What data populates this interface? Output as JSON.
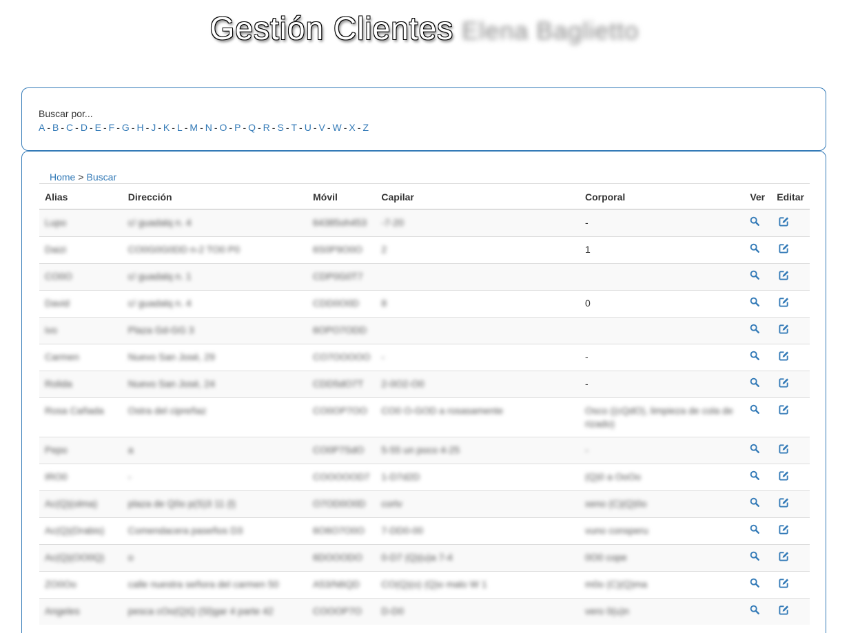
{
  "header": {
    "title": "Gestión Clientes",
    "owner_name": "Elena Baglietto"
  },
  "search": {
    "label": "Buscar por...",
    "letters": [
      "A",
      "B",
      "C",
      "D",
      "E",
      "F",
      "G",
      "H",
      "J",
      "K",
      "L",
      "M",
      "N",
      "O",
      "P",
      "Q",
      "R",
      "S",
      "T",
      "U",
      "V",
      "W",
      "X",
      "Z"
    ],
    "separator": "-"
  },
  "breadcrumb": {
    "home": "Home",
    "separator": ">",
    "current": "Buscar"
  },
  "table": {
    "headers": {
      "alias": "Alias",
      "direccion": "Dirección",
      "movil": "Móvil",
      "capilar": "Capilar",
      "corporal": "Corporal",
      "ver": "Ver",
      "editar": "Editar"
    },
    "rows": [
      {
        "alias": "Lupo",
        "direccion": "c/ guadalq n. 4",
        "movil": "64385oh453",
        "capilar": "-7-20",
        "corporal": "-",
        "corporal_clear": true
      },
      {
        "alias": "Daizi",
        "direccion": "CO0G0G0DD n-2 TO0 P0",
        "movil": "6S0P9O0O",
        "capilar": "2",
        "corporal": "1",
        "corporal_clear": true
      },
      {
        "alias": "CO0O",
        "direccion": "c/ guadalq n. 1",
        "movil": "CDP0G0T7",
        "capilar": "",
        "corporal": "",
        "corporal_clear": true
      },
      {
        "alias": "David",
        "direccion": "c/ guadalq n. 4",
        "movil": "CDD0O0D",
        "capilar": "8",
        "corporal": "0",
        "corporal_clear": true
      },
      {
        "alias": "ivo",
        "direccion": "Plaza Gd-GG 3",
        "movil": "6OPO7ODD",
        "capilar": "",
        "corporal": "",
        "corporal_clear": true
      },
      {
        "alias": "Carmen",
        "direccion": "Nuevo San José, 29",
        "movil": "CO7OOOOO",
        "capilar": "-",
        "corporal": "-",
        "corporal_clear": true
      },
      {
        "alias": "Rolida",
        "direccion": "Nuevo San José, 24",
        "movil": "CDD5dO7T",
        "capilar": "2-0O2-O0",
        "corporal": "-",
        "corporal_clear": true
      },
      {
        "alias": "Rosa Cañada",
        "direccion": "Ostra del cipreñaz",
        "movil": "CO0OP7OO",
        "capilar": "CO0 O-GOD a rosasamente",
        "corporal": "Osco ((cQdO), limpieza de cola de rizado)",
        "corporal_clear": false
      },
      {
        "alias": "Pepo",
        "direccion": "a",
        "movil": "CO0P7SdO",
        "capilar": "5-55 un poco 4-25",
        "corporal": "-",
        "corporal_clear": false
      },
      {
        "alias": "IRO0",
        "direccion": "-",
        "movil": "COOOOOD7",
        "capilar": "1-D7d2D",
        "corporal": "(Q)0 a OoOo",
        "corporal_clear": false
      },
      {
        "alias": "Ac(Q)(olma)",
        "direccion": "plaza de Q0o p(S)3 11 (l)",
        "movil": "O7OD0O0D",
        "capilar": "cortv",
        "corporal": "xeno (C)(Q)0o",
        "corporal_clear": false
      },
      {
        "alias": "Ac(Q)(Drabis)",
        "direccion": "Comendacera paseños D3",
        "movil": "6O6O7O0O",
        "capilar": "7-DD0-00",
        "corporal": "vuno consperu",
        "corporal_clear": false
      },
      {
        "alias": "Ac(Q)(OO0Q)",
        "direccion": "o",
        "movil": "6DOOODO",
        "capilar": "0-D7 (Q)(u)a 7-4",
        "corporal": "0O0 cope",
        "corporal_clear": false
      },
      {
        "alias": "ZO0Oo",
        "direccion": "calle nuestra señora del carmen 50",
        "movil": "A53/N6QD",
        "capilar": "CO(Q)(o) (Q)o malo W 1",
        "corporal": "m0o (C)(Q)ma",
        "corporal_clear": false
      },
      {
        "alias": "Angeles",
        "direccion": "pesca cOo(Q)Q (Sl)gar 4 parte 42",
        "movil": "COOOP7O",
        "capilar": "D-D0",
        "corporal": "vero 0(u)n",
        "corporal_clear": false
      }
    ]
  },
  "icons": {
    "ver": "magnifier-icon",
    "editar": "edit-icon"
  },
  "colors": {
    "accent": "#337ab7",
    "border": "#337ab7",
    "stripe": "#f9f9f9"
  }
}
